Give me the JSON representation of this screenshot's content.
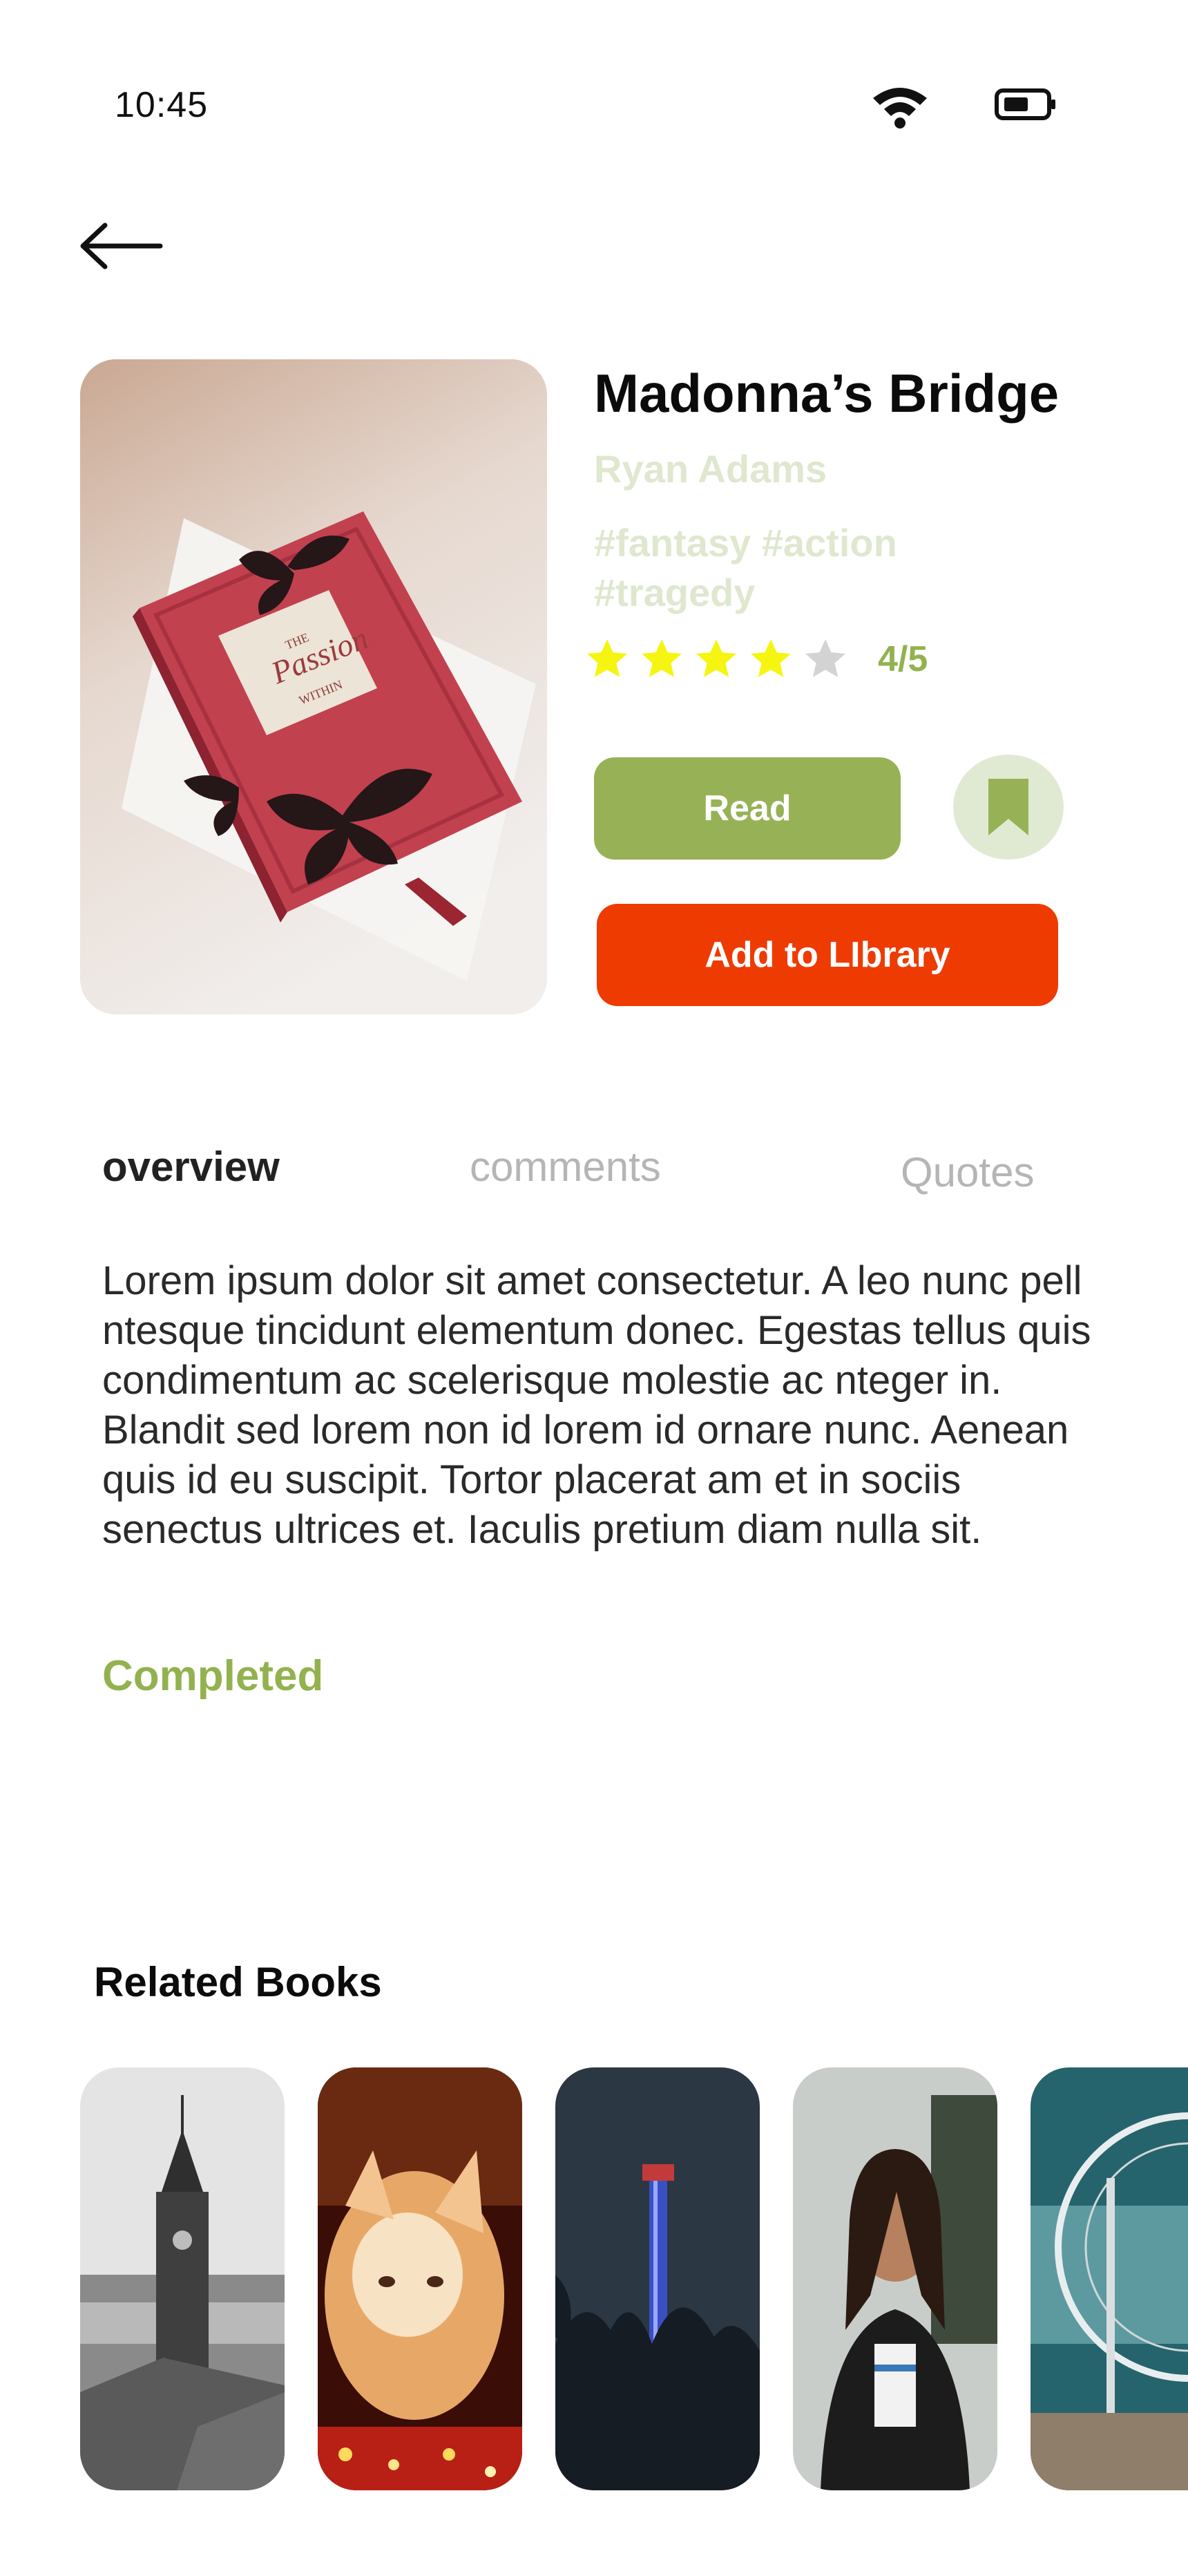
{
  "status_bar": {
    "time": "10:45"
  },
  "book": {
    "title": "Madonna’s Bridge",
    "author": "Ryan Adams",
    "tags": [
      "#fantasy #action",
      "#tragedy"
    ],
    "rating_text": "4/5",
    "rating_value": 4,
    "rating_max": 5
  },
  "actions": {
    "read_label": "Read",
    "add_library_label": "Add to LIbrary"
  },
  "tabs": [
    {
      "label": "overview",
      "active": true
    },
    {
      "label": "comments",
      "active": false
    },
    {
      "label": "Quotes",
      "active": false
    }
  ],
  "overview": {
    "text": "Lorem ipsum dolor sit amet consectetur. A leo nunc pell ntesque tincidunt elementum donec. Egestas tellus quis condimentum ac scelerisque molestie ac nteger in. Blandit sed lorem non id lorem id ornare nunc. Aenean quis id eu suscipit. Tortor placerat am et in sociis senectus ultrices et. Iaculis pretium diam nulla sit.",
    "status": "Completed"
  },
  "related": {
    "title": "Related Books"
  },
  "colors": {
    "accent_green": "#97b256",
    "accent_orange": "#ee3b02",
    "pale_green": "#dfe8cf",
    "star_yellow": "#f5f511",
    "star_grey": "#d3d3d3"
  },
  "icons": [
    "back-arrow-icon",
    "wifi-icon",
    "battery-icon",
    "bookmark-icon",
    "star-icon"
  ]
}
